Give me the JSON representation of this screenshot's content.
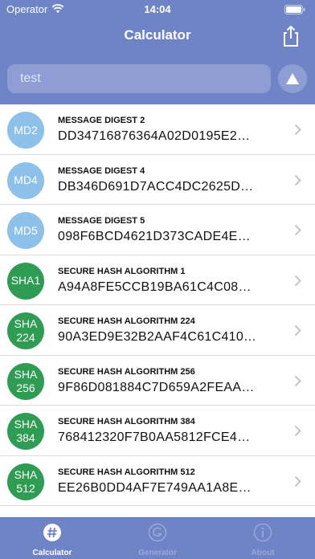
{
  "status": {
    "carrier": "Operator",
    "time": "14:04"
  },
  "nav": {
    "title": "Calculator"
  },
  "search": {
    "value": "test",
    "placeholder": ""
  },
  "rows": [
    {
      "badge_line1": "MD2",
      "badge_line2": "",
      "kind": "md",
      "title": "MESSAGE DIGEST 2",
      "value": "DD34716876364A02D0195E2…"
    },
    {
      "badge_line1": "MD4",
      "badge_line2": "",
      "kind": "md",
      "title": "MESSAGE DIGEST 4",
      "value": "DB346D691D7ACC4DC2625D…"
    },
    {
      "badge_line1": "MD5",
      "badge_line2": "",
      "kind": "md",
      "title": "MESSAGE DIGEST 5",
      "value": "098F6BCD4621D373CADE4E…"
    },
    {
      "badge_line1": "SHA1",
      "badge_line2": "",
      "kind": "sha",
      "title": "SECURE HASH ALGORITHM 1",
      "value": "A94A8FE5CCB19BA61C4C08…"
    },
    {
      "badge_line1": "SHA",
      "badge_line2": "224",
      "kind": "sha",
      "title": "SECURE HASH ALGORITHM 224",
      "value": "90A3ED9E32B2AAF4C61C410…"
    },
    {
      "badge_line1": "SHA",
      "badge_line2": "256",
      "kind": "sha",
      "title": "SECURE HASH ALGORITHM 256",
      "value": "9F86D081884C7D659A2FEAA…"
    },
    {
      "badge_line1": "SHA",
      "badge_line2": "384",
      "kind": "sha",
      "title": "SECURE HASH ALGORITHM 384",
      "value": "768412320F7B0AA5812FCE4…"
    },
    {
      "badge_line1": "SHA",
      "badge_line2": "512",
      "kind": "sha",
      "title": "SECURE HASH ALGORITHM 512",
      "value": "EE26B0DD4AF7E749AA1A8E…"
    }
  ],
  "tabs": [
    {
      "label": "Calculator",
      "icon": "hash-icon",
      "active": true
    },
    {
      "label": "Generator",
      "icon": "g-circle-icon",
      "active": false
    },
    {
      "label": "About",
      "icon": "info-icon",
      "active": false
    }
  ],
  "colors": {
    "header": "#6f84c7",
    "md_badge": "#8ec1ea",
    "sha_badge": "#2e9c52"
  }
}
